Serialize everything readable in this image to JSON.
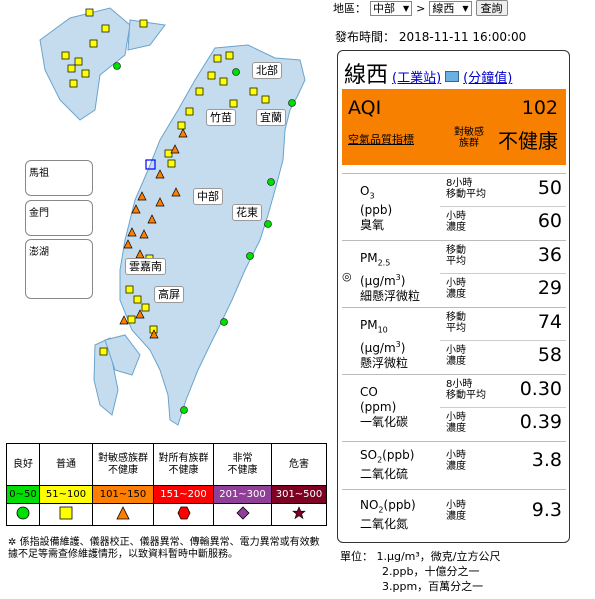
{
  "selectors": {
    "area_label": "地區：",
    "area_value": "中部",
    "separator": ">",
    "station_value": "線西",
    "query_button": "查詢"
  },
  "publish": {
    "label": "發布時間：",
    "time": "2018-11-11 16:00:00"
  },
  "station": {
    "name": "線西",
    "industrial_link": "(工業站)",
    "minute_link": "(分鐘值)"
  },
  "aqi": {
    "label": "AQI",
    "value": "102",
    "index_link": "空氣品質指標",
    "caption": "對敏感\n族群",
    "status": "不健康",
    "color": "#f88000"
  },
  "pollutants": [
    {
      "name": "O3\n(ppb)\n臭氧",
      "name_html_parts": [
        "O",
        "3",
        "(ppb)",
        "臭氧"
      ],
      "rows": [
        {
          "period": "8小時\n移動平均",
          "value": "50"
        },
        {
          "period": "小時\n濃度",
          "value": "60"
        }
      ]
    },
    {
      "name_html_parts": [
        "PM",
        "2.5",
        "(μg/m",
        "3",
        ")",
        "細懸浮微粒"
      ],
      "rows": [
        {
          "period": "移動\n平均",
          "value": "36"
        },
        {
          "period": "小時\n濃度",
          "value": "29"
        }
      ]
    },
    {
      "name_html_parts": [
        "PM",
        "10",
        "(μg/m",
        "3",
        ")",
        "懸浮微粒"
      ],
      "rows": [
        {
          "period": "移動\n平均",
          "value": "74"
        },
        {
          "period": "小時\n濃度",
          "value": "58"
        }
      ]
    },
    {
      "name_html_parts": [
        "CO",
        "",
        "(ppm)",
        "",
        "",
        "一氧化碳"
      ],
      "rows": [
        {
          "period": "8小時\n移動平均",
          "value": "0.30"
        },
        {
          "period": "小時\n濃度",
          "value": "0.39"
        }
      ]
    },
    {
      "name_html_parts": [
        "SO",
        "2",
        "(ppb)",
        "",
        "",
        "二氧化硫"
      ],
      "rows": [
        {
          "period": "小時\n濃度",
          "value": "3.8"
        }
      ]
    },
    {
      "name_html_parts": [
        "NO",
        "2",
        "(ppb)",
        "",
        "",
        "二氧化氮"
      ],
      "rows": [
        {
          "period": "小時\n濃度",
          "value": "9.3"
        }
      ]
    }
  ],
  "units": {
    "label": "單位：",
    "lines": [
      "1.μg/m³，微克/立方公尺",
      "2.ppb，十億分之一",
      "3.ppm，百萬分之一"
    ]
  },
  "map": {
    "regions": [
      "北部",
      "竹苗",
      "宜蘭",
      "中部",
      "花東",
      "雲嘉南",
      "高屏"
    ],
    "insets": [
      "馬祖",
      "金門",
      "澎湖"
    ]
  },
  "legend": {
    "headers": [
      "良好",
      "普通",
      "對敏感族群\n不健康",
      "對所有族群\n不健康",
      "非常\n不健康",
      "危害"
    ],
    "ranges": [
      "0~50",
      "51~100",
      "101~150",
      "151~200",
      "201~300",
      "301~500"
    ],
    "colors": [
      "#00e000",
      "#ffff00",
      "#ff7e00",
      "#ff0000",
      "#8f3f97",
      "#7e0023"
    ],
    "note": "係指設備維護、儀器校正、儀器異常、傳輸異常、電力異常或有效數據不足等需查修維護情形，以致資料暫時中斷服務。"
  }
}
